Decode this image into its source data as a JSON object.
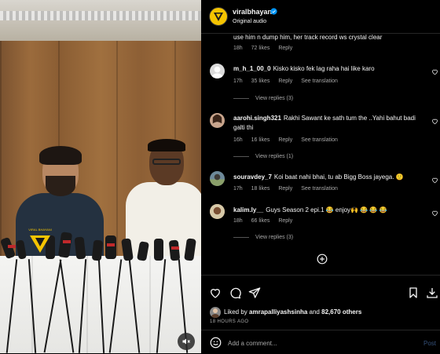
{
  "header": {
    "username": "viralbhayani",
    "audio": "Original audio",
    "avatar_icon": "viral-bhayani-logo-icon"
  },
  "video": {
    "watermark": "VIRAL BHAYANI",
    "mute_icon": "speaker-muted-icon"
  },
  "comments": [
    {
      "user": "",
      "text": "use him n dump him, her track record ws crystal clear",
      "time": "18h",
      "likes": "72 likes",
      "reply": "Reply",
      "translation": ""
    },
    {
      "user": "m_h_1_00_0",
      "text": "Kisko kisko fek lag raha hai like karo",
      "time": "17h",
      "likes": "35 likes",
      "reply": "Reply",
      "translation": "See translation",
      "view_replies": "View replies (3)"
    },
    {
      "user": "aarohi.singh321",
      "text": "Rakhi Sawant ke sath tum the ..Yahi bahut badi galti thi",
      "time": "16h",
      "likes": "16 likes",
      "reply": "Reply",
      "translation": "See translation",
      "view_replies": "View replies (1)"
    },
    {
      "user": "souravdey_7",
      "text": "Koi baat nahi bhai, tu ab Bigg Boss jayega. 🙂",
      "time": "17h",
      "likes": "18 likes",
      "reply": "Reply",
      "translation": "See translation"
    },
    {
      "user": "kalim.ly__",
      "text": "Guys Season 2 epi.1 😂 enjoy🙌 😂 😂 😂",
      "time": "18h",
      "likes": "66 likes",
      "reply": "Reply",
      "translation": "",
      "view_replies": "View replies (3)"
    }
  ],
  "actions": {
    "liked_prefix": "Liked by",
    "liked_user": "amrapalliyashsinha",
    "liked_and": "and",
    "liked_others": "82,670 others",
    "time": "18 HOURS AGO"
  },
  "add_comment": {
    "placeholder": "Add a comment...",
    "post": "Post"
  },
  "colors": {
    "accent_yellow": "#f5c400",
    "verified_blue": "#0095f6",
    "post_disabled": "#35517a",
    "muted_text": "#a8a8a8"
  }
}
